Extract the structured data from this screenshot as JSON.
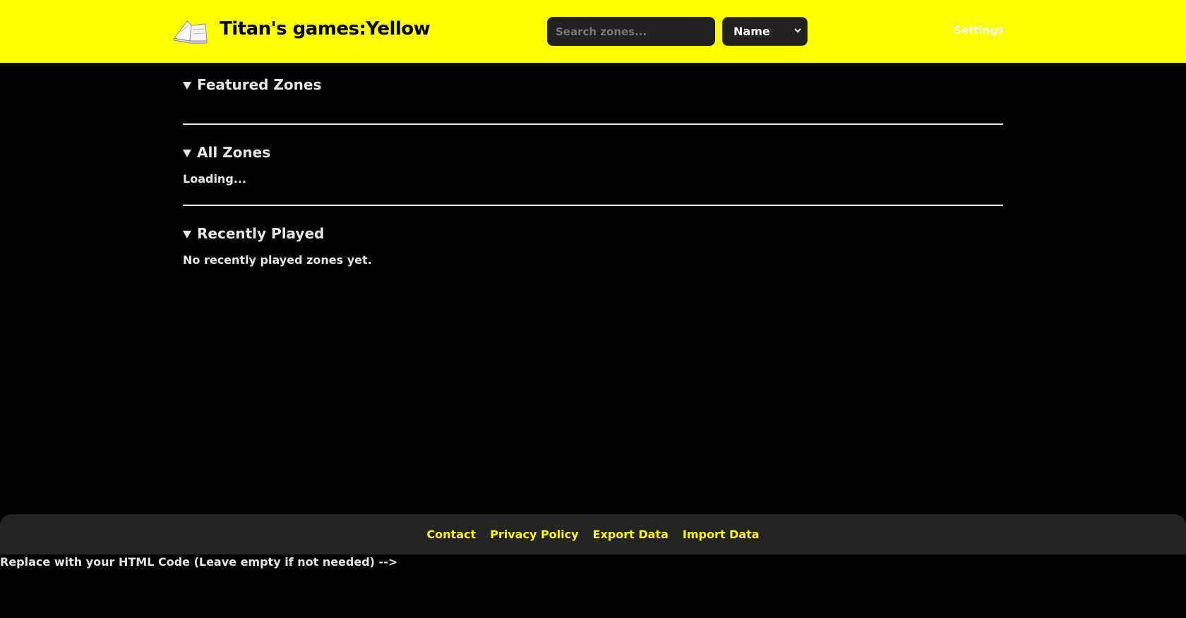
{
  "header": {
    "title": "Titan's games:Yellow",
    "logo_icon": "open-book-icon",
    "search": {
      "placeholder": "Search zones...",
      "value": ""
    },
    "sort": {
      "selected": "Name"
    },
    "settings_label": "Settings"
  },
  "sections": {
    "featured": {
      "title": "Featured Zones",
      "body": ""
    },
    "all": {
      "title": "All Zones",
      "body": "Loading..."
    },
    "recent": {
      "title": "Recently Played",
      "body": "No recently played zones yet."
    }
  },
  "footer": {
    "links": [
      "Contact",
      "Privacy Policy",
      "Export Data",
      "Import Data"
    ]
  },
  "bottom_note": "Replace with your HTML Code (Leave empty if not needed) -->",
  "colors": {
    "header_bg": "#ffff00",
    "page_bg": "#000000",
    "footer_bg": "#242424",
    "link": "#ffff00",
    "text": "#e6e6e6"
  }
}
